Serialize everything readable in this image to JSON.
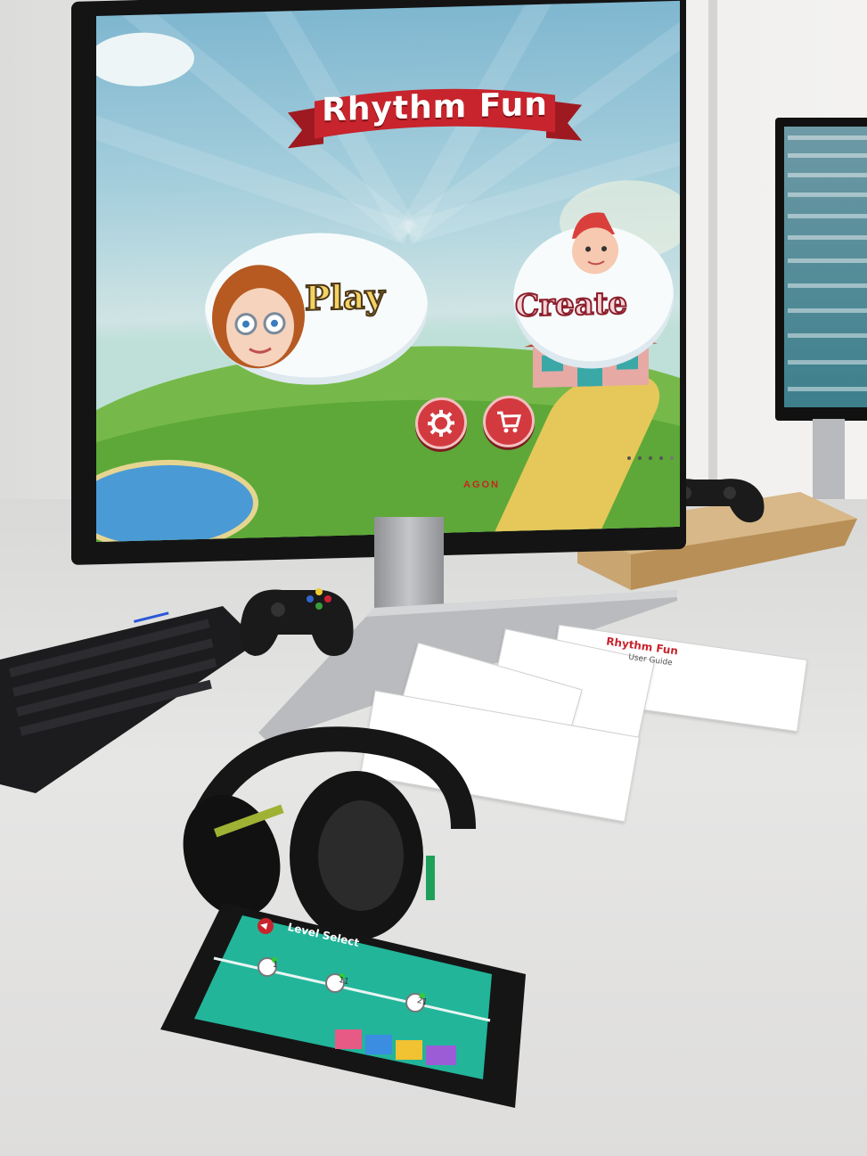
{
  "monitor": {
    "brand": "AGON",
    "game": {
      "title": "Rhythm Fun",
      "play_label": "Play",
      "create_label": "Create",
      "settings_icon": "gear-icon",
      "cart_icon": "shopping-cart-icon"
    }
  },
  "phone": {
    "screen_title": "Level Select",
    "back_icon": "back-arrow-icon",
    "levels": [
      "1",
      "11",
      "21"
    ]
  },
  "guides": {
    "title": "Rhythm Fun",
    "subtitle": "User Guide"
  },
  "colors": {
    "banner_red": "#c8242d",
    "phone_teal": "#22b59a",
    "grass_green": "#5da838",
    "button_red": "#d33a3f"
  }
}
